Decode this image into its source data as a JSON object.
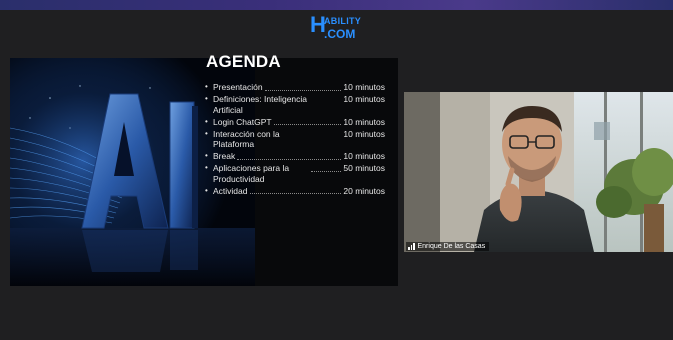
{
  "slide": {
    "logo": {
      "mark": "H",
      "top_text": "ABILITY",
      "bottom_text": ".COM",
      "color": "#2a8fff"
    },
    "art_text": "AI",
    "title": "AGENDA",
    "items": [
      {
        "label": "Presentación",
        "time": "10 minutos"
      },
      {
        "label": "Definiciones: Inteligencia Artificial",
        "time": "10 minutos"
      },
      {
        "label": "Login ChatGPT",
        "time": "10 minutos"
      },
      {
        "label": "Interacción con la Plataforma",
        "time": "10 minutos"
      },
      {
        "label": "Break",
        "time": "10 minutos"
      },
      {
        "label": "Aplicaciones para la Productividad",
        "time": "50 minutos"
      },
      {
        "label": "Actividad",
        "time": "20 minutos"
      }
    ]
  },
  "video": {
    "participant_name": "Enrique De las Casas",
    "icon": "signal-bars-icon"
  },
  "colors": {
    "accent": "#2a8fff",
    "background": "#1f1f21",
    "top_bar": "#3a2f7a"
  }
}
